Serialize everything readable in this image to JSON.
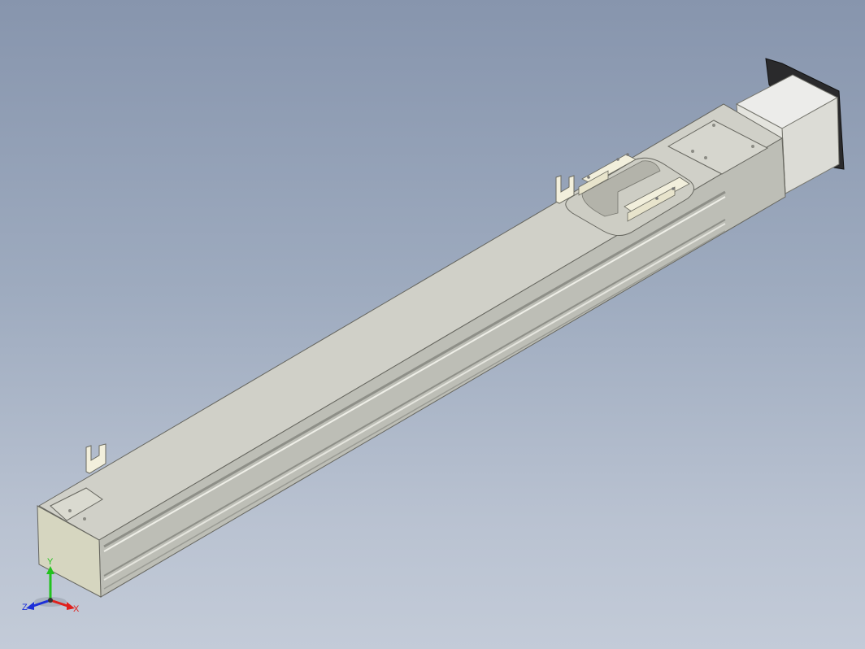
{
  "triad": {
    "x_label": "X",
    "y_label": "Y",
    "z_label": "Z",
    "colors": {
      "x": "#e0201c",
      "y": "#22c21e",
      "z": "#1c2fd8"
    }
  },
  "model": {
    "colors": {
      "profile_top": "#d2d2c9",
      "profile_side": "#bfc0b8",
      "end_cap": "#d6d6c2",
      "motor_body": "#e6e6e2",
      "motor_flange": "#2a2a2c",
      "carriage": "#cfcfc6",
      "bracket": "#f2efdc",
      "edge": "#55554f"
    }
  }
}
